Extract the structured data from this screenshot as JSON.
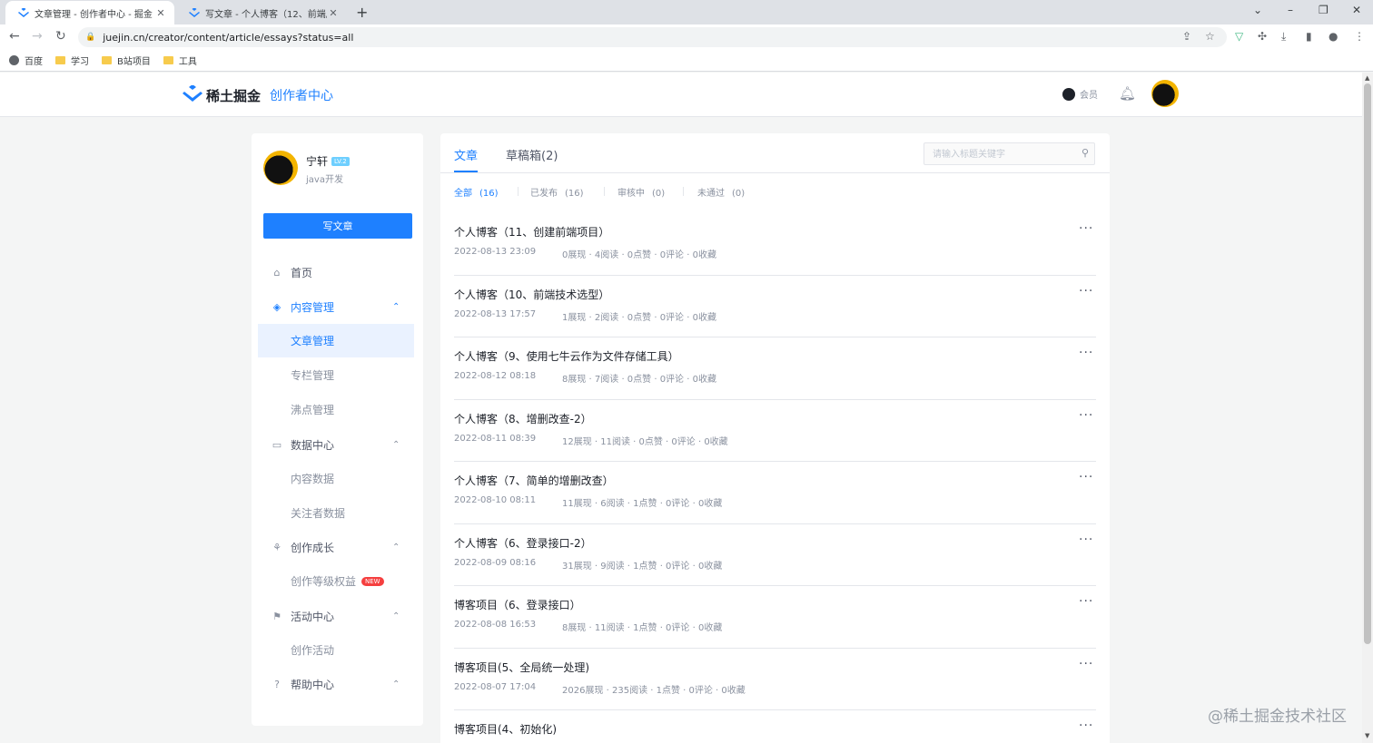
{
  "browser": {
    "tabs": [
      {
        "title": "文章管理 - 创作者中心 - 掘金",
        "close": "✕"
      },
      {
        "title": "写文章 - 个人博客（12、前端后",
        "close": "✕"
      }
    ],
    "new_tab": "+",
    "window_controls": {
      "dropdown": "⌄",
      "minimize": "–",
      "restore": "❐",
      "close": "✕"
    },
    "url": "juejin.cn/creator/content/article/essays?status=all",
    "nav": {
      "back": "←",
      "forward": "→",
      "reload": "↻"
    },
    "bookmarks": [
      "百度",
      "学习",
      "B站项目",
      "工具"
    ]
  },
  "header": {
    "brand": "稀土掘金",
    "section": "创作者中心",
    "vip_label": "会员"
  },
  "sidebar": {
    "user": {
      "name": "宁轩",
      "level": "LV.2",
      "title": "java开发"
    },
    "write_button": "写文章",
    "home": "首页",
    "content_mgmt": "内容管理",
    "content_children": [
      "文章管理",
      "专栏管理",
      "沸点管理"
    ],
    "data_center": "数据中心",
    "data_children": [
      "内容数据",
      "关注者数据"
    ],
    "growth": "创作成长",
    "growth_child": "创作等级权益",
    "new_badge": "NEW",
    "activity": "活动中心",
    "activity_child": "创作活动",
    "help": "帮助中心"
  },
  "content": {
    "tabs": [
      "文章",
      "草稿箱(2)"
    ],
    "search_placeholder": "请输入标题关键字",
    "filters": [
      {
        "label": "全部",
        "count": "(16)"
      },
      {
        "label": "已发布",
        "count": "(16)"
      },
      {
        "label": "审核中",
        "count": "(0)"
      },
      {
        "label": "未通过",
        "count": "(0)"
      }
    ],
    "articles": [
      {
        "title": "个人博客（11、创建前端项目）",
        "date": "2022-08-13 23:09",
        "stats": "0展现 · 4阅读 · 0点赞 · 0评论 · 0收藏"
      },
      {
        "title": "个人博客（10、前端技术选型）",
        "date": "2022-08-13 17:57",
        "stats": "1展现 · 2阅读 · 0点赞 · 0评论 · 0收藏"
      },
      {
        "title": "个人博客（9、使用七牛云作为文件存储工具）",
        "date": "2022-08-12 08:18",
        "stats": "8展现 · 7阅读 · 0点赞 · 0评论 · 0收藏"
      },
      {
        "title": "个人博客（8、增删改查-2）",
        "date": "2022-08-11 08:39",
        "stats": "12展现 · 11阅读 · 0点赞 · 0评论 · 0收藏"
      },
      {
        "title": "个人博客（7、简单的增删改查）",
        "date": "2022-08-10 08:11",
        "stats": "11展现 · 6阅读 · 1点赞 · 0评论 · 0收藏"
      },
      {
        "title": "个人博客（6、登录接口-2）",
        "date": "2022-08-09 08:16",
        "stats": "31展现 · 9阅读 · 1点赞 · 0评论 · 0收藏"
      },
      {
        "title": "博客项目（6、登录接口）",
        "date": "2022-08-08 16:53",
        "stats": "8展现 · 11阅读 · 1点赞 · 0评论 · 0收藏"
      },
      {
        "title": "博客项目(5、全局统一处理)",
        "date": "2022-08-07 17:04",
        "stats": "2026展现 · 235阅读 · 1点赞 · 0评论 · 0收藏"
      },
      {
        "title": "博客项目(4、初始化)",
        "date": "",
        "stats": ""
      }
    ],
    "more_glyph": "···"
  },
  "watermark": "@稀土掘金技术社区",
  "colors": {
    "accent": "#1e80ff",
    "page_bg": "#f4f5f5",
    "text_secondary": "#8a919f"
  }
}
